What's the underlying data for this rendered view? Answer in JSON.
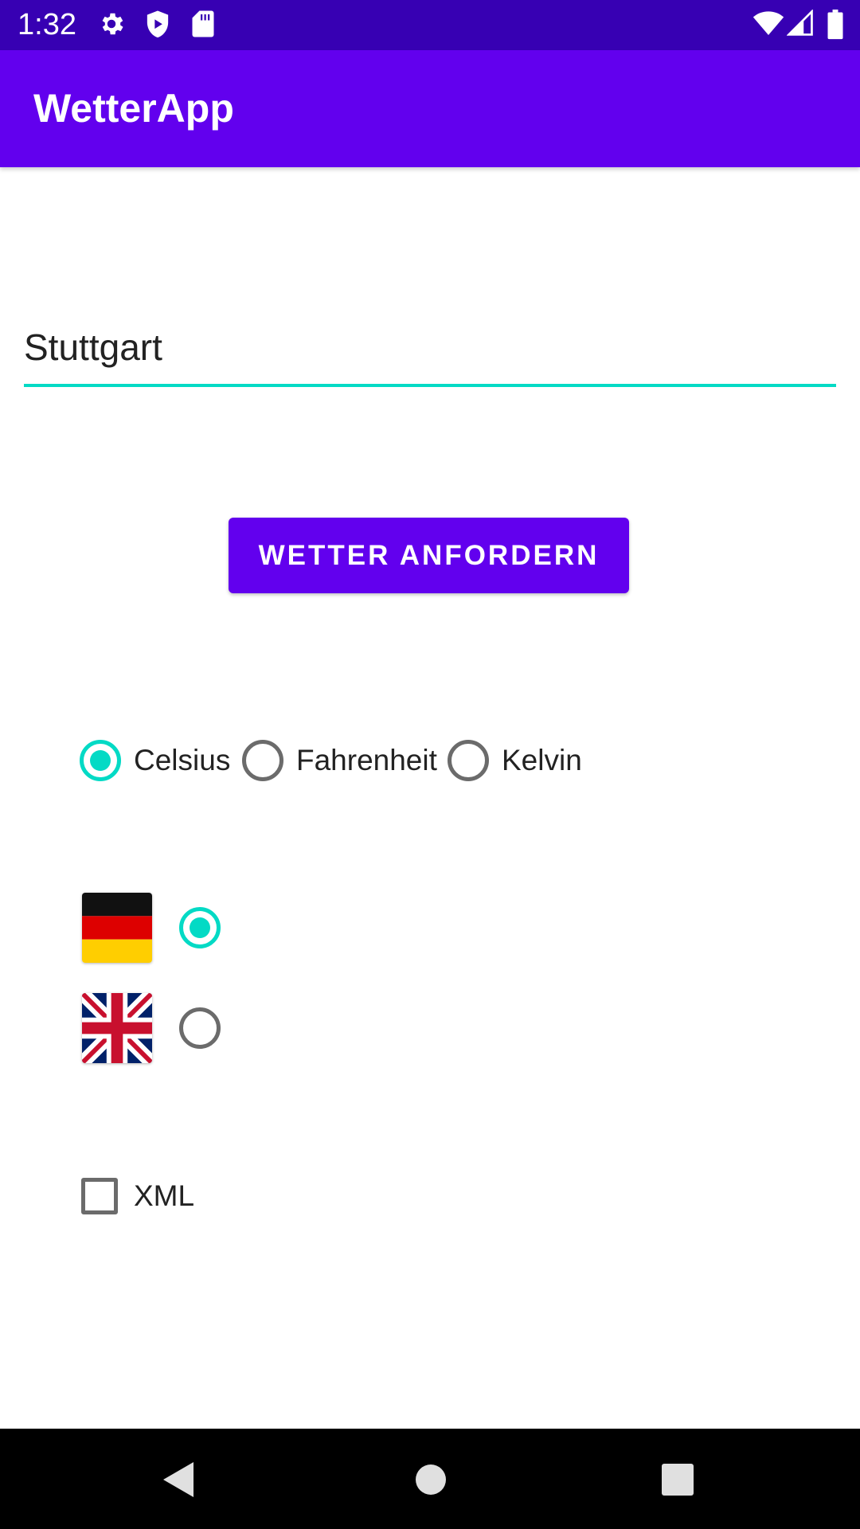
{
  "status_bar": {
    "time": "1:32",
    "icons": [
      "gear-icon",
      "shield-icon",
      "sd-card-icon",
      "wifi-icon",
      "signal-icon",
      "battery-icon"
    ]
  },
  "app_bar": {
    "title": "WetterApp"
  },
  "city_input": {
    "value": "Stuttgart"
  },
  "request_button": {
    "label": "WETTER ANFORDERN"
  },
  "unit_options": [
    {
      "label": "Celsius",
      "checked": true
    },
    {
      "label": "Fahrenheit",
      "checked": false
    },
    {
      "label": "Kelvin",
      "checked": false
    }
  ],
  "language_options": [
    {
      "flag": "germany-flag-icon",
      "checked": true
    },
    {
      "flag": "uk-flag-icon",
      "checked": false
    }
  ],
  "xml_checkbox": {
    "label": "XML",
    "checked": false
  },
  "nav_bar": {
    "icons": [
      "back-icon",
      "home-icon",
      "recents-icon"
    ]
  },
  "colors": {
    "primary": "#6200EE",
    "primary_dark": "#3700B3",
    "accent": "#03DAC5"
  }
}
